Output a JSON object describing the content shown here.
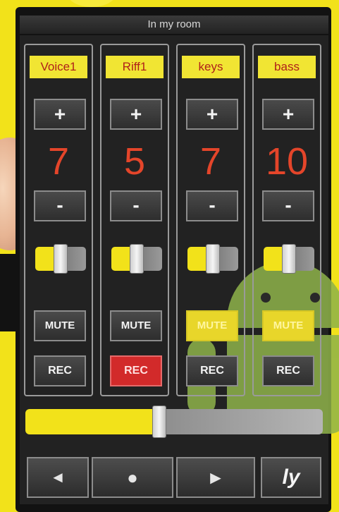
{
  "window": {
    "title": "In my room"
  },
  "channels": [
    {
      "label": "Voice1",
      "plus": "+",
      "value": "7",
      "minus": "-",
      "mute_label": "MUTE",
      "mute_active": false,
      "rec_label": "REC",
      "rec_active": false
    },
    {
      "label": "Riff1",
      "plus": "+",
      "value": "5",
      "minus": "-",
      "mute_label": "MUTE",
      "mute_active": false,
      "rec_label": "REC",
      "rec_active": true
    },
    {
      "label": "keys",
      "plus": "+",
      "value": "7",
      "minus": "-",
      "mute_label": "MUTE",
      "mute_active": true,
      "rec_label": "REC",
      "rec_active": false
    },
    {
      "label": "bass",
      "plus": "+",
      "value": "10",
      "minus": "-",
      "mute_label": "MUTE",
      "mute_active": true,
      "rec_label": "REC",
      "rec_active": false
    }
  ],
  "master_slider": {
    "level": 0.45
  },
  "transport": {
    "prev_icon": "◄",
    "record_icon": "●",
    "play_icon": "►",
    "logo_text": "ly"
  },
  "colors": {
    "accent_yellow": "#f2e21a",
    "value_red": "#e4452a",
    "rec_active_red": "#d22a2a"
  },
  "icons": {
    "prev": "skip-back-icon",
    "record": "record-icon",
    "play": "play-icon"
  }
}
